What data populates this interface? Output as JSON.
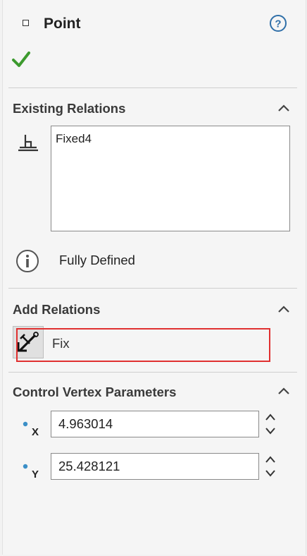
{
  "header": {
    "title": "Point",
    "point_icon": "point-icon",
    "help_icon": "question-circle-icon",
    "ok_icon": "green-checkmark-icon"
  },
  "existing_relations": {
    "title": "Existing Relations",
    "icon": "relation-icon",
    "items": [
      "Fixed4"
    ],
    "status_icon": "info-circle-icon",
    "status": "Fully Defined"
  },
  "add_relations": {
    "title": "Add Relations",
    "items": [
      {
        "label": "Fix",
        "icon": "anchor-fix-icon"
      }
    ]
  },
  "control_vertex": {
    "title": "Control Vertex Parameters",
    "x": {
      "icon": "x-coordinate-icon",
      "value": "4.963014"
    },
    "y": {
      "icon": "y-coordinate-icon",
      "value": "25.428121"
    }
  },
  "colors": {
    "highlight": "#e03030",
    "ok_green": "#3c9a2e",
    "help_blue": "#2f6fa8"
  }
}
